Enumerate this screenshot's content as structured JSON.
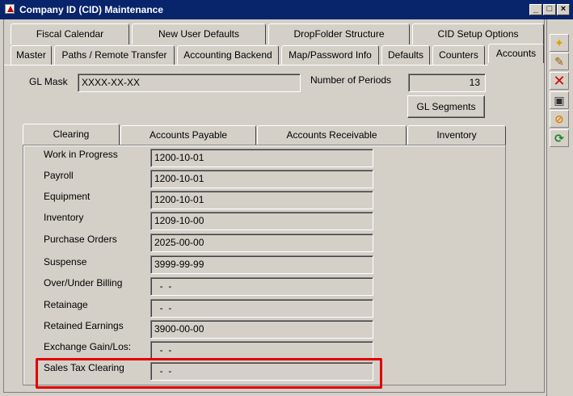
{
  "window": {
    "title": "Company ID (CID) Maintenance",
    "min_label": "_",
    "max_label": "□",
    "close_label": "×"
  },
  "tabs_top": [
    "Fiscal Calendar",
    "New User Defaults",
    "DropFolder Structure",
    "CID Setup Options"
  ],
  "tabs_second": [
    "Master",
    "Paths / Remote Transfer",
    "Accounting Backend",
    "Map/Password Info",
    "Defaults",
    "Counters",
    "Accounts"
  ],
  "gl": {
    "mask_label": "GL Mask",
    "mask_value": "XXXX-XX-XX",
    "periods_label": "Number of Periods",
    "periods_value": "13",
    "segments_button": "GL Segments"
  },
  "sub_tabs": [
    "Clearing",
    "Accounts Payable",
    "Accounts Receivable",
    "Inventory"
  ],
  "clearing_rows": [
    {
      "label": "Work in Progress",
      "value": "1200-10-01"
    },
    {
      "label": "Payroll",
      "value": "1200-10-01"
    },
    {
      "label": "Equipment",
      "value": "1200-10-01"
    },
    {
      "label": "Inventory",
      "value": "1209-10-00"
    },
    {
      "label": "Purchase Orders",
      "value": "2025-00-00"
    },
    {
      "label": "Suspense",
      "value": "3999-99-99"
    },
    {
      "label": "Over/Under Billing",
      "value": "  -  -"
    },
    {
      "label": "Retainage",
      "value": "  -  -"
    },
    {
      "label": "Retained Earnings",
      "value": "3900-00-00"
    },
    {
      "label": "Exchange Gain/Los:",
      "value": "  -  -"
    },
    {
      "label": "Sales Tax Clearing",
      "value": "  -  -"
    }
  ],
  "toolbar_icons": [
    "new-record-icon",
    "edit-icon",
    "delete-icon",
    "save-icon",
    "cancel-icon",
    "refresh-icon"
  ],
  "colors": {
    "title_bar": "#08246b",
    "highlight": "#e00000"
  }
}
